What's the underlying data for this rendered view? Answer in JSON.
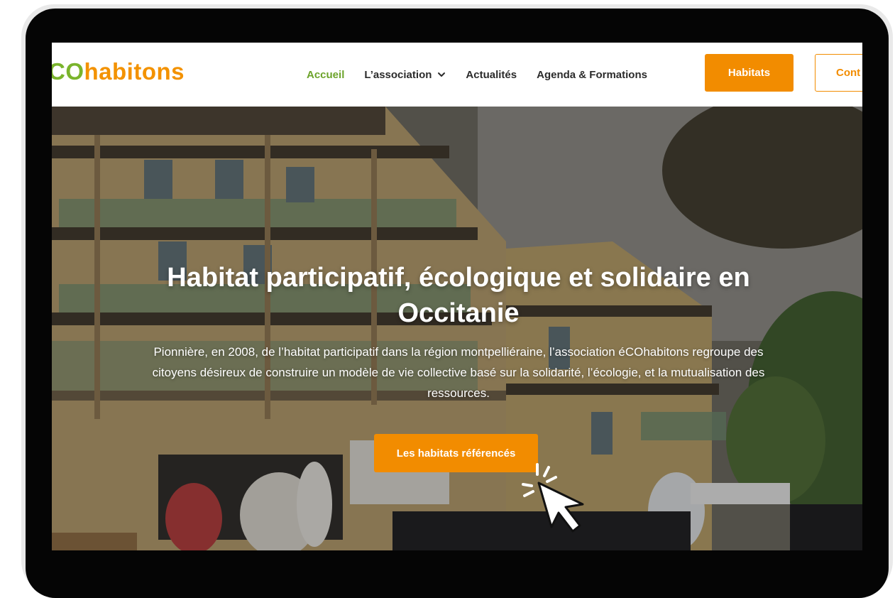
{
  "logo": {
    "part1": "CO",
    "part2": "habitons"
  },
  "nav": {
    "items": [
      {
        "label": "Accueil",
        "active": true
      },
      {
        "label": "L’association",
        "has_dropdown": true
      },
      {
        "label": "Actualités"
      },
      {
        "label": "Agenda & Formations"
      }
    ],
    "habitats_button": "Habitats",
    "contact_button": "Cont"
  },
  "hero": {
    "title": "Habitat participatif, écologique et solidaire en Occitanie",
    "text": "Pionnière, en 2008, de l’habitat participatif dans la région montpelliéraine, l’association éCOhabitons regroupe des citoyens désireux de construire un modèle de vie collective basé sur la solidarité, l’écologie, et la mutualisation des ressources.",
    "cta": "Les habitats référencés"
  },
  "colors": {
    "accent_orange": "#f28c00",
    "accent_green": "#6ca32a",
    "frame": "#050505"
  },
  "icons": [
    "chevron-down-icon",
    "click-cursor-icon"
  ]
}
